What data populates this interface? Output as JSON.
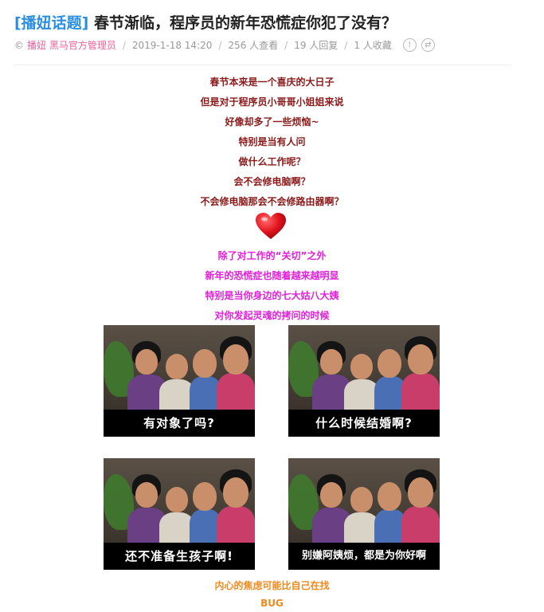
{
  "post": {
    "tag": "[播妞话题]",
    "title": "春节渐临，程序员的新年恐慌症你犯了没有？"
  },
  "meta": {
    "copyright_symbol": "©",
    "author": "播妞 黑马官方管理员",
    "date": "2019-1-18 14:20",
    "views": "256 人查看",
    "replies": "19 人回复",
    "favorites": "1 人收藏",
    "separator": "/",
    "icon_names": [
      "info-circle-icon",
      "share-circle-icon"
    ]
  },
  "content": {
    "lines_dark": [
      "春节本来是一个喜庆的大日子",
      "但是对于程序员小哥哥小姐姐来说",
      "好像却多了一些烦恼~",
      "特别是当有人问",
      "做什么工作呢？",
      "会不会修电脑啊？",
      "不会修电脑那会不会修路由器啊？"
    ],
    "lines_magenta": [
      "除了对工作的“关切”之外",
      "新年的恐慌症也随着越来越明显",
      "特别是当你身边的七大姑八大姨",
      "对你发起灵魂的拷问的时候"
    ],
    "memes": [
      {
        "caption": "有对象了吗?"
      },
      {
        "caption": "什么时候结婚啊?"
      },
      {
        "caption": "还不准备生孩子啊!"
      },
      {
        "caption": "别嫌阿姨烦，都是为你好啊"
      }
    ],
    "lines_orange": [
      "内心的焦虑可能比自己在找",
      "BUG"
    ]
  },
  "colors": {
    "tag": "#2a8fe0",
    "author": "#e8629a",
    "dark_text": "#8b1a1a",
    "magenta_text": "#e020d8",
    "orange_text": "#f08a1c",
    "heart": "#e3131f"
  }
}
